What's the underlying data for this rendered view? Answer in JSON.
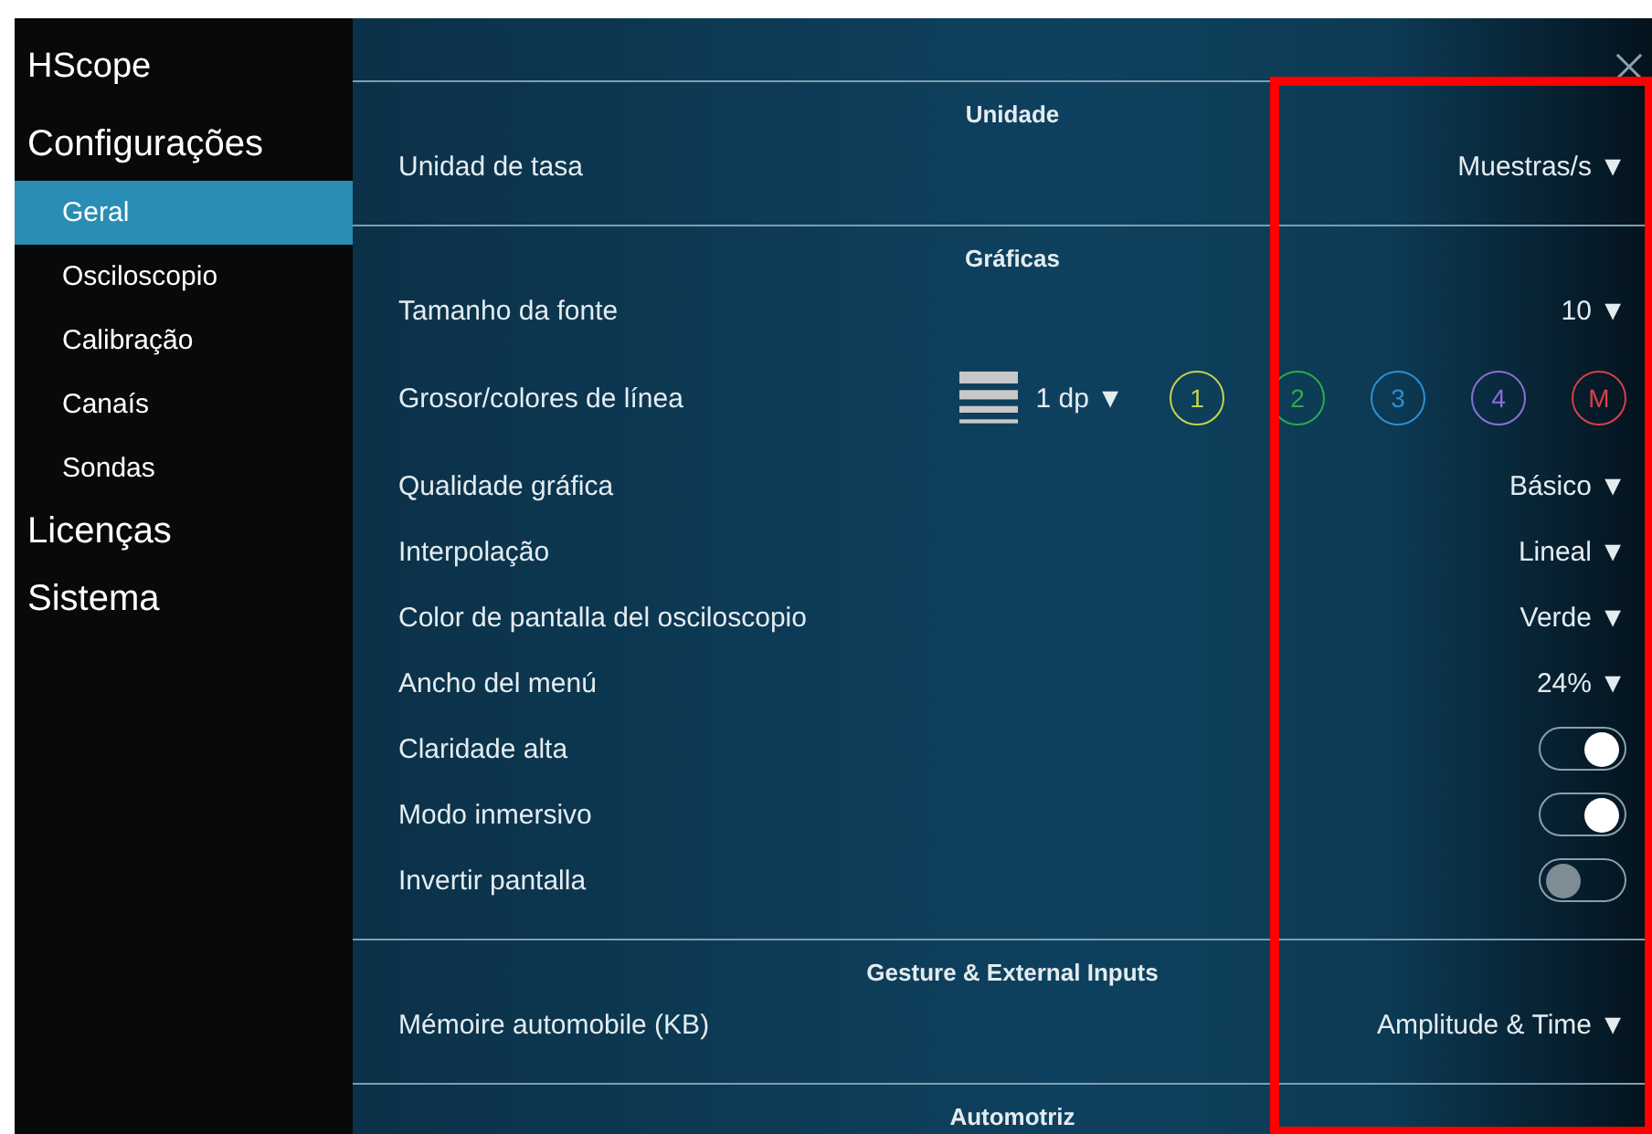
{
  "sidebar": {
    "app_title": "HScope",
    "groups": [
      {
        "label": "Configurações",
        "items": [
          {
            "label": "Geral",
            "selected": true
          },
          {
            "label": "Osciloscopio",
            "selected": false
          },
          {
            "label": "Calibração",
            "selected": false
          },
          {
            "label": "Canaís",
            "selected": false
          },
          {
            "label": "Sondas",
            "selected": false
          }
        ]
      },
      {
        "label": "Licenças"
      },
      {
        "label": "Sistema"
      }
    ]
  },
  "sections": [
    {
      "title": "Unidade",
      "rows": [
        {
          "kind": "dropdown",
          "label": "Unidad de tasa",
          "value": "Muestras/s ▼"
        }
      ]
    },
    {
      "title": "Gráficas",
      "rows": [
        {
          "kind": "dropdown",
          "label": "Tamanho da fonte",
          "value": "10 ▼"
        },
        {
          "kind": "lines",
          "label": "Grosor/colores de línea",
          "value": "1 dp ▼",
          "channels": [
            {
              "label": "1",
              "color": "#c8d24a"
            },
            {
              "label": "2",
              "color": "#2faa4a"
            },
            {
              "label": "3",
              "color": "#2f8fd0"
            },
            {
              "label": "4",
              "color": "#8a6fd8"
            },
            {
              "label": "M",
              "color": "#d8404a"
            }
          ]
        },
        {
          "kind": "dropdown",
          "label": "Qualidade gráfica",
          "value": "Básico ▼"
        },
        {
          "kind": "dropdown",
          "label": "Interpolação",
          "value": "Lineal ▼"
        },
        {
          "kind": "dropdown",
          "label": "Color de pantalla del osciloscopio",
          "value": "Verde ▼"
        },
        {
          "kind": "dropdown",
          "label": "Ancho del menú",
          "value": "24% ▼"
        },
        {
          "kind": "toggle",
          "label": "Claridade alta",
          "on": true
        },
        {
          "kind": "toggle",
          "label": "Modo inmersivo",
          "on": true
        },
        {
          "kind": "toggle",
          "label": "Invertir pantalla",
          "on": false
        }
      ]
    },
    {
      "title": "Gesture & External Inputs",
      "rows": [
        {
          "kind": "dropdown",
          "label": "Mémoire automobile (KB)",
          "value": "Amplitude & Time ▼"
        }
      ]
    },
    {
      "title": "Automotriz"
    }
  ],
  "highlight_box": true
}
